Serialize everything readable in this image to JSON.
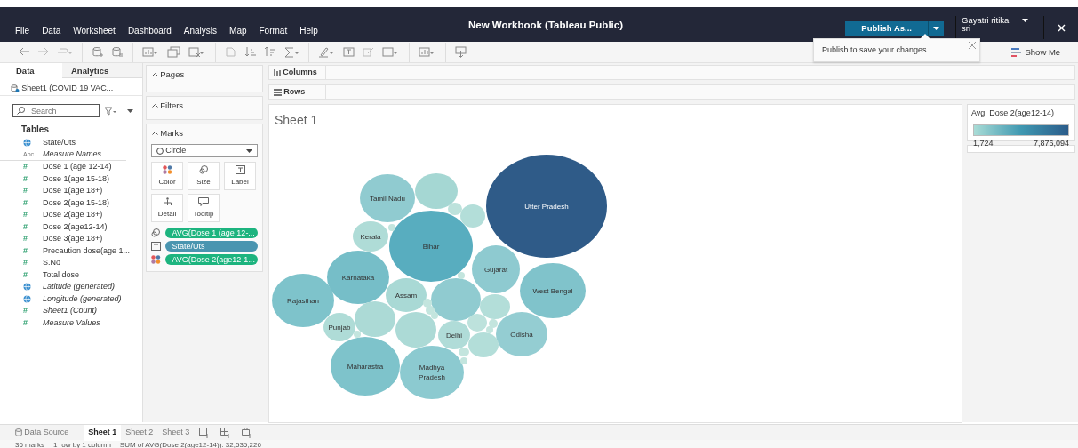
{
  "app_bar": {
    "menu": [
      "File",
      "Data",
      "Worksheet",
      "Dashboard",
      "Analysis",
      "Map",
      "Format",
      "Help"
    ],
    "title": "New Workbook (Tableau Public)",
    "publish_button": "Publish As...",
    "user": "Gayatri ritika sri"
  },
  "popup": {
    "text": "Publish to save your changes"
  },
  "show_me": "Show Me",
  "data_pane": {
    "tabs": [
      {
        "label": "Data",
        "selected": true
      },
      {
        "label": "Analytics",
        "selected": false
      }
    ],
    "source": "Sheet1 (COVID 19 VAC...",
    "search": {
      "placeholder": "Search"
    },
    "tables_heading": "Tables",
    "fields": [
      {
        "kind": "geo",
        "name": "State/Uts",
        "italic": false
      },
      {
        "kind": "string",
        "type_mark": "Abc",
        "name": "Measure Names",
        "italic": true
      },
      {
        "kind": "measure",
        "type_mark": "#",
        "name": "Dose 1 (age 12-14)",
        "italic": false
      },
      {
        "kind": "measure",
        "type_mark": "#",
        "name": "Dose 1(age 15-18)",
        "italic": false
      },
      {
        "kind": "measure",
        "type_mark": "#",
        "name": "Dose 1(age 18+)",
        "italic": false
      },
      {
        "kind": "measure",
        "type_mark": "#",
        "name": "Dose 2(age 15-18)",
        "italic": false
      },
      {
        "kind": "measure",
        "type_mark": "#",
        "name": "Dose 2(age 18+)",
        "italic": false
      },
      {
        "kind": "measure",
        "type_mark": "#",
        "name": "Dose 2(age12-14)",
        "italic": false
      },
      {
        "kind": "measure",
        "type_mark": "#",
        "name": "Dose 3(age 18+)",
        "italic": false
      },
      {
        "kind": "measure",
        "type_mark": "#",
        "name": "Precaution dose(age 1...",
        "italic": false
      },
      {
        "kind": "measure",
        "type_mark": "#",
        "name": "S.No",
        "italic": false
      },
      {
        "kind": "measure",
        "type_mark": "#",
        "name": "Total dose",
        "italic": false
      },
      {
        "kind": "geo",
        "name": "Latitude (generated)",
        "italic": true
      },
      {
        "kind": "geo",
        "name": "Longitude (generated)",
        "italic": true
      },
      {
        "kind": "measure",
        "type_mark": "#",
        "name": "Sheet1 (Count)",
        "italic": true
      },
      {
        "kind": "measure",
        "type_mark": "#",
        "name": "Measure Values",
        "italic": true
      }
    ]
  },
  "cards": {
    "pages": "Pages",
    "filters": "Filters"
  },
  "marks": {
    "title": "Marks",
    "mark_type": "Circle",
    "buttons": [
      {
        "kind": "color",
        "label": "Color"
      },
      {
        "kind": "size",
        "label": "Size"
      },
      {
        "kind": "label",
        "label": "Label"
      },
      {
        "kind": "detail",
        "label": "Detail"
      },
      {
        "kind": "tooltip",
        "label": "Tooltip"
      }
    ],
    "pills": [
      {
        "kind": "size",
        "label": "AVG(Dose 1 (age 12-...",
        "color": "#1db47f"
      },
      {
        "kind": "label",
        "label": "State/Uts",
        "color": "#4a95b0"
      },
      {
        "kind": "color",
        "label": "AVG(Dose 2(age12-1...",
        "color": "#1db47f"
      }
    ]
  },
  "shelves": {
    "columns": "Columns",
    "rows": "Rows"
  },
  "sheet_title": "Sheet 1",
  "bubbles": [
    {
      "label": "Utter Pradesh",
      "color": "#2f5b88"
    },
    {
      "label": "Tamil Nadu",
      "color": "#90cbd0"
    },
    {
      "label": "Kerala",
      "color": "#afdcd7"
    },
    {
      "label": "Bihar",
      "color": "#58adbf"
    },
    {
      "label": "Gujarat",
      "color": "#8ecad0"
    },
    {
      "label": "Karnataka",
      "color": "#76bec8"
    },
    {
      "label": "Rajasthan",
      "color": "#7ec3cb"
    },
    {
      "label": "Assam",
      "color": "#a9d9d5"
    },
    {
      "label": "West Bengal",
      "color": "#80c3cb"
    },
    {
      "label": "Punjab",
      "color": "#afdcd7"
    },
    {
      "label": "Delhi",
      "color": "#b0dcd8"
    },
    {
      "label": "Odisha",
      "color": "#94cdd2"
    },
    {
      "label": "Maharastra",
      "color": "#7ec3cb"
    },
    {
      "label": "Madhya Pradesh",
      "color": "#8ccad0"
    },
    {
      "color": "#a5d7d3"
    },
    {
      "color": "#bde2dc"
    },
    {
      "color": "#b3ded9"
    },
    {
      "color": "#90cbd0"
    },
    {
      "color": "#b3ded9"
    },
    {
      "color": "#acdad6"
    },
    {
      "color": "#acdad6"
    },
    {
      "color": "#bde2dc"
    },
    {
      "color": "#b3ded9"
    },
    {
      "color": "#c3e5de"
    },
    {
      "color": "#c3e5de"
    },
    {
      "color": "#c3e5de"
    },
    {
      "color": "#c3e5de"
    },
    {
      "color": "#c3e5de"
    },
    {
      "color": "#c3e5de"
    },
    {
      "color": "#c3e5de"
    },
    {
      "color": "#c3e5de"
    },
    {
      "color": "#c3e5de"
    },
    {
      "color": "#c3e5de"
    }
  ],
  "legend": {
    "title": "Avg. Dose 2(age12-14)",
    "min": "1,724",
    "max": "7,876,094"
  },
  "sheet_tabs": [
    {
      "kind": "source",
      "label": "Data Source",
      "selected": false
    },
    {
      "kind": "sheet",
      "label": "Sheet 1",
      "selected": true
    },
    {
      "kind": "sheet",
      "label": "Sheet 2",
      "selected": false
    },
    {
      "kind": "sheet",
      "label": "Sheet 3",
      "selected": false
    }
  ],
  "status_bar": [
    "36 marks",
    "1 row by 1 column",
    "SUM of AVG(Dose 2(age12-14)): 32,535,226"
  ]
}
